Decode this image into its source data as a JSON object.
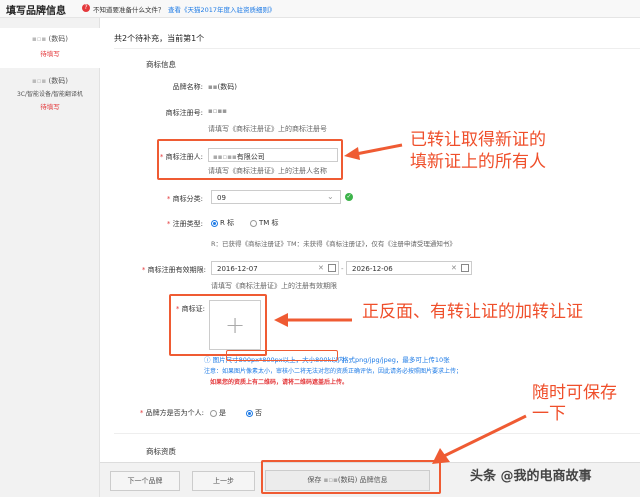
{
  "header": {
    "title": "填写品牌信息",
    "help_text": "不知道要准备什么文件？",
    "help_link": "查看《天猫2017年度入驻资质细则》"
  },
  "sidebar": {
    "items": [
      {
        "name": "(数码)",
        "category": "",
        "status": "待填写"
      },
      {
        "name": "(数码)",
        "category": "3C/智能设备/智能翻译机",
        "status": "待填写"
      }
    ]
  },
  "main": {
    "progress": "共2个待补充，当前第1个",
    "section_title": "商标信息",
    "brand_name_label": "品牌名称:",
    "brand_name_value": "(数码)",
    "reg_no_label": "商标注册号:",
    "reg_no_hint": "请填写《商标注册证》上的商标注册号",
    "registrant_label": "商标注册人:",
    "registrant_value": "有限公司",
    "registrant_hint": "请填写《商标注册证》上的注册人名称",
    "category_label": "商标分类:",
    "category_value": "09",
    "reg_type_label": "注册类型:",
    "reg_type_options": [
      "R 标",
      "TM 标"
    ],
    "reg_type_note": "R：已获得《商标注册证》TM：未获得《商标注册证》，仅有《注册申请受理通知书》",
    "validity_label": "商标注册有效期限:",
    "validity_start": "2016-12-07",
    "validity_end": "2026-12-06",
    "validity_hint": "请填写《商标注册证》上的注册有效期限",
    "cert_label": "商标证:",
    "img_hint_prefix": "图片尺寸800px*800px以上，大小800k以内",
    "img_hint_suffix": "格式png/jpg/jpeg，最多可上传10张",
    "img_note": "注意：如果图片像素太小，审核小二将无法对您的资质正确评估，因此请务必按照图片要求上传；",
    "img_warning": "如果您的资质上有二维码，请将二维码遮盖后上传。",
    "personal_label": "品牌方是否为个人:",
    "personal_options": [
      "是",
      "否"
    ],
    "qualification_title": "商标资质"
  },
  "footer": {
    "next_brand": "下一个品牌",
    "prev_step": "上一步",
    "save": "保存",
    "save_brand": "(数码)",
    "save_suffix": "品牌信息"
  },
  "annotations": {
    "a1_line1": "已转让取得新证的",
    "a1_line2": "填新证上的所有人",
    "a2": "正反面、有转让证的加转让证",
    "a3_line1": "随时可保存",
    "a3_line2": "一下"
  },
  "watermark": "头条 @我的电商故事",
  "colors": {
    "accent": "#ef5b33",
    "required": "#e4393c",
    "link": "#1e7be6"
  }
}
